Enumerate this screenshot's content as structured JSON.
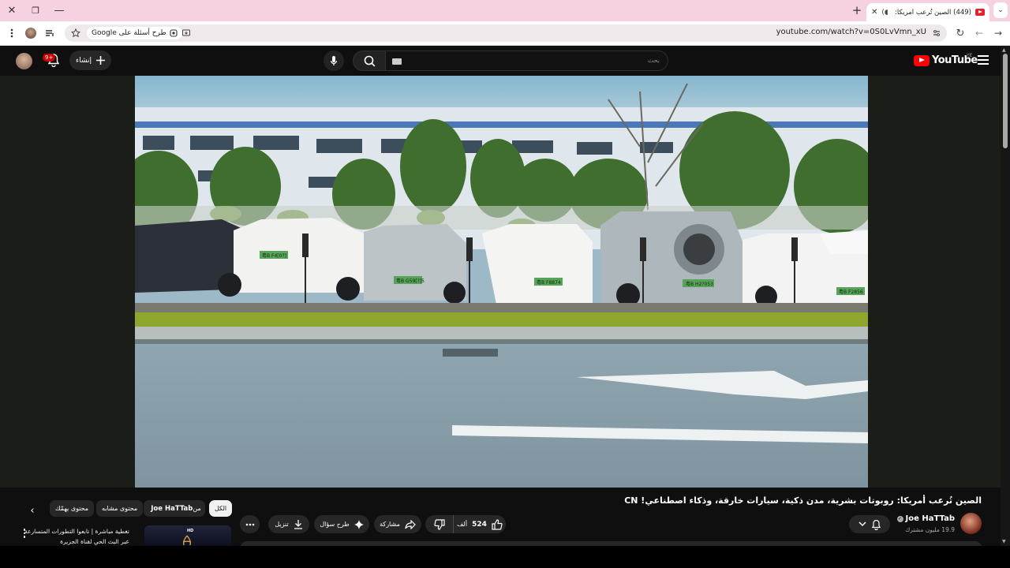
{
  "browser": {
    "tab": {
      "title": "(449) الصين تُرعب أمريكا: رو",
      "audio_icon": "speaker-icon",
      "close_icon": "close-icon"
    },
    "new_tab_icon": "plus-icon",
    "tab_search_icon": "chevron-down-icon",
    "window_controls": {
      "close_icon": "close-icon",
      "restore_icon": "restore-icon",
      "minimize_icon": "minimize-icon"
    },
    "omnibox": {
      "url": "youtube.com/watch?v=0S0LvVmn_xU",
      "ask_chip_label": "طرح أسئلة على Google"
    }
  },
  "youtube": {
    "logo_text": "YouTube",
    "country_code": "YE",
    "search_placeholder": "بحث",
    "create_label": "إنشاء",
    "notifications_badge": "9+",
    "accent_color": "#ff0000"
  },
  "video": {
    "title": "الصين تُرعب أمريكا: روبوتات بشرية، مدن ذكية، سيارات خارقة، وذكاء اصطناعي! CN",
    "scene_plates": [
      "粤B F4[0?]",
      "粤B G59[?]5",
      "粤B F8874",
      "粤B H2?053",
      "粤B F2856"
    ]
  },
  "channel": {
    "name": "Joe HaTTab",
    "subscribers": "19.9 مليون مشترك"
  },
  "actions": {
    "like_count": "524",
    "like_unit": "ألف",
    "share_label": "مشاركة",
    "ask_label": "طرح سؤال",
    "download_label": "تنزيل"
  },
  "related": {
    "chips": {
      "all": "الكل",
      "from_label": "من",
      "from_channel": "Joe HaTTab",
      "similar": "محتوى مشابه",
      "for_you": "محتوى يهمّك"
    },
    "item": {
      "title": "تغطية مباشرة | تابعوا التطورات المتسارعة عبر البث الحي لقناة الجزيرة",
      "badge": "HD"
    }
  }
}
